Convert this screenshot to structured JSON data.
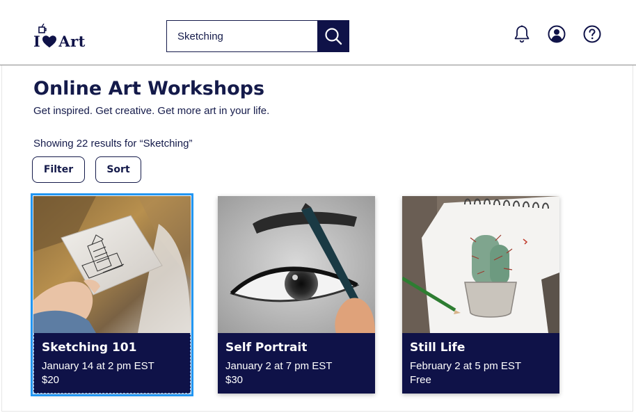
{
  "header": {
    "logo": {
      "letter": "I",
      "suffix": "Art"
    },
    "search": {
      "value": "Sketching",
      "placeholder": "Search"
    },
    "icons": [
      "bell-icon",
      "account-icon",
      "help-icon"
    ]
  },
  "page": {
    "title": "Online Art Workshops",
    "tagline": "Get inspired. Get creative. Get more art in your life.",
    "results_text": "Showing 22 results for “Sketching”",
    "filter_label": "Filter",
    "sort_label": "Sort"
  },
  "cards": [
    {
      "title": "Sketching 101",
      "date": "January 14 at 2 pm EST",
      "price": "$20",
      "selected": true
    },
    {
      "title": "Self Portrait",
      "date": "January 2 at 7 pm EST",
      "price": "$30",
      "selected": false
    },
    {
      "title": "Still Life",
      "date": "February 2 at 5 pm EST",
      "price": "Free",
      "selected": false
    }
  ],
  "colors": {
    "brand_navy": "#0f1248",
    "text": "#141a4a",
    "selection": "#2196f3",
    "card_text": "#ffffff"
  }
}
